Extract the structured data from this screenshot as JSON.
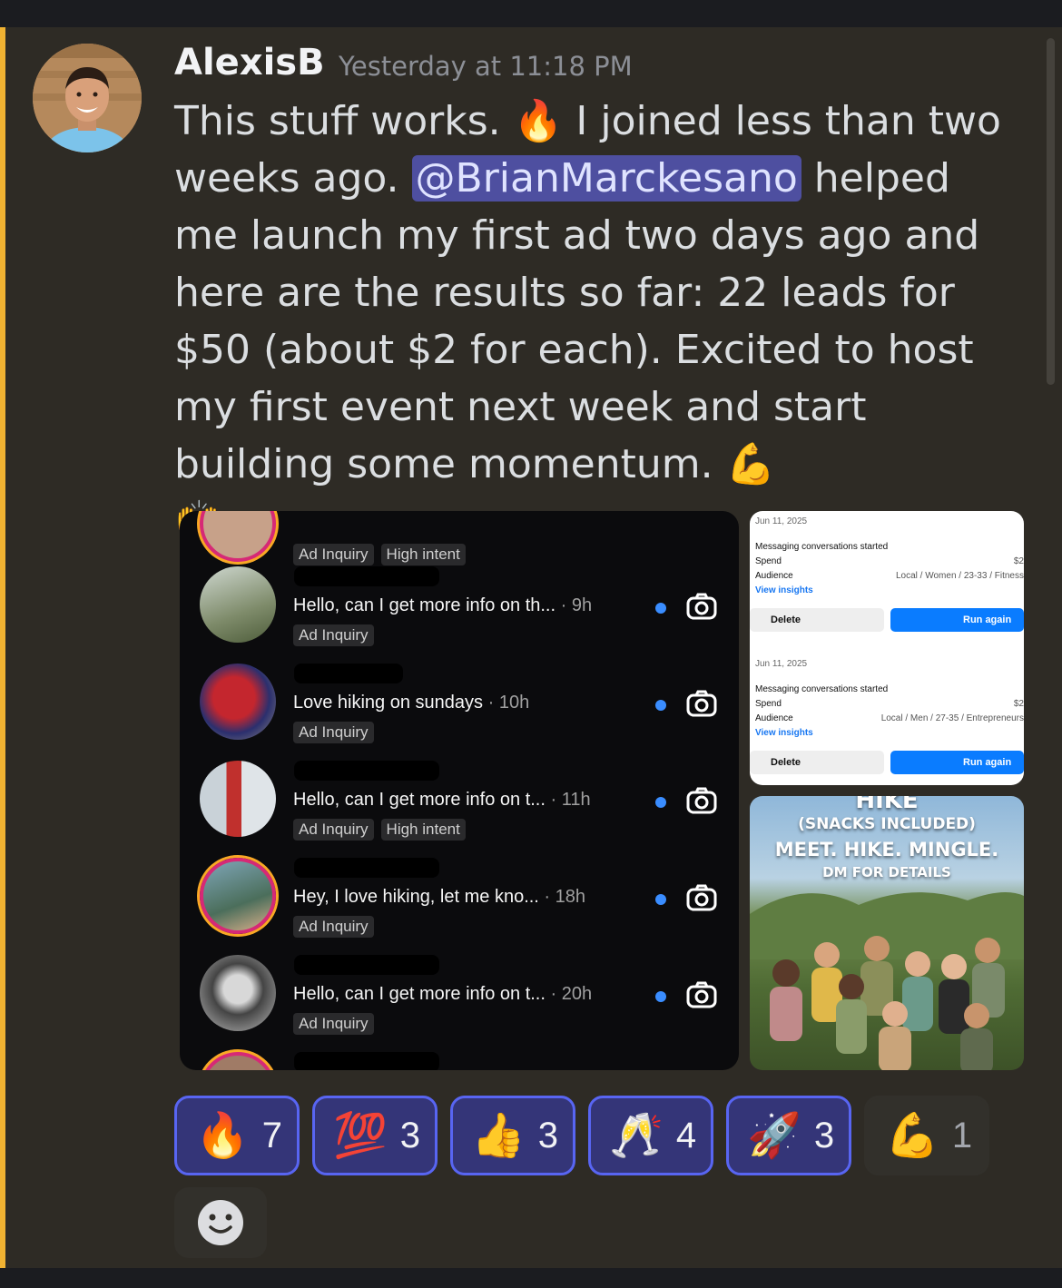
{
  "message": {
    "username": "AlexisB",
    "timestamp": "Yesterday at 11:18 PM",
    "text_1": "This stuff works. ",
    "emoji_fire": "🔥",
    "text_2": " I joined less than two weeks ago. ",
    "mention": "@BrianMarckesano",
    "text_3": "  helped me launch my first ad two days ago and here are the results so far: 22 leads for $50 (about $2 for each). Excited to host my first event next week and start building some momentum. ",
    "emoji_muscle": "💪",
    "emoji_hands": "🙌"
  },
  "dm_list": {
    "rows": [
      {
        "preview": "",
        "time": "",
        "tags": [
          "Ad Inquiry",
          "High intent"
        ],
        "unread": false
      },
      {
        "preview": "Hello, can I get more info on th...",
        "time": " · 9h",
        "tags": [
          "Ad Inquiry"
        ],
        "unread": true
      },
      {
        "preview": "Love hiking on sundays",
        "time": " · 10h",
        "tags": [
          "Ad Inquiry"
        ],
        "unread": true
      },
      {
        "preview": "Hello, can I get more info on t...",
        "time": " · 11h",
        "tags": [
          "Ad Inquiry",
          "High intent"
        ],
        "unread": true
      },
      {
        "preview": "Hey, I love hiking, let me kno...",
        "time": " · 18h",
        "tags": [
          "Ad Inquiry"
        ],
        "unread": true
      },
      {
        "preview": "Hello, can I get more info on t...",
        "time": " · 20h",
        "tags": [
          "Ad Inquiry"
        ],
        "unread": true
      }
    ]
  },
  "ads": [
    {
      "date": "Jun 11, 2025",
      "title": "Messaging conversations started",
      "spend_label": "Spend",
      "spend_value": "$2",
      "audience_label": "Audience",
      "audience_value": "Local / Women / 23-33 / Fitness",
      "insights": "View insights",
      "delete": "Delete",
      "run_again": "Run again"
    },
    {
      "date": "Jun 11, 2025",
      "title": "Messaging conversations started",
      "spend_label": "Spend",
      "spend_value": "$2",
      "audience_label": "Audience",
      "audience_value": "Local / Men / 27-35 / Entrepreneurs",
      "insights": "View insights",
      "delete": "Delete",
      "run_again": "Run again"
    }
  ],
  "poster": {
    "line_top": "HIKE",
    "line_1": "(SNACKS INCLUDED)",
    "line_2": "MEET. HIKE. MINGLE.",
    "line_3": "DM FOR DETAILS"
  },
  "reactions": [
    {
      "emoji": "🔥",
      "count": "7",
      "selected": true
    },
    {
      "emoji": "💯",
      "count": "3",
      "selected": true
    },
    {
      "emoji": "👍",
      "count": "3",
      "selected": true
    },
    {
      "emoji": "🥂",
      "count": "4",
      "selected": true
    },
    {
      "emoji": "🚀",
      "count": "3",
      "selected": true
    },
    {
      "emoji": "💪",
      "count": "1",
      "selected": false
    }
  ],
  "icons": {
    "add_reaction": "smile-icon",
    "dm_camera": "camera-icon"
  },
  "colors": {
    "accent_bar": "#f0b232",
    "mention_bg": "#4e4fa0",
    "reaction_selected_border": "#5865f2"
  }
}
